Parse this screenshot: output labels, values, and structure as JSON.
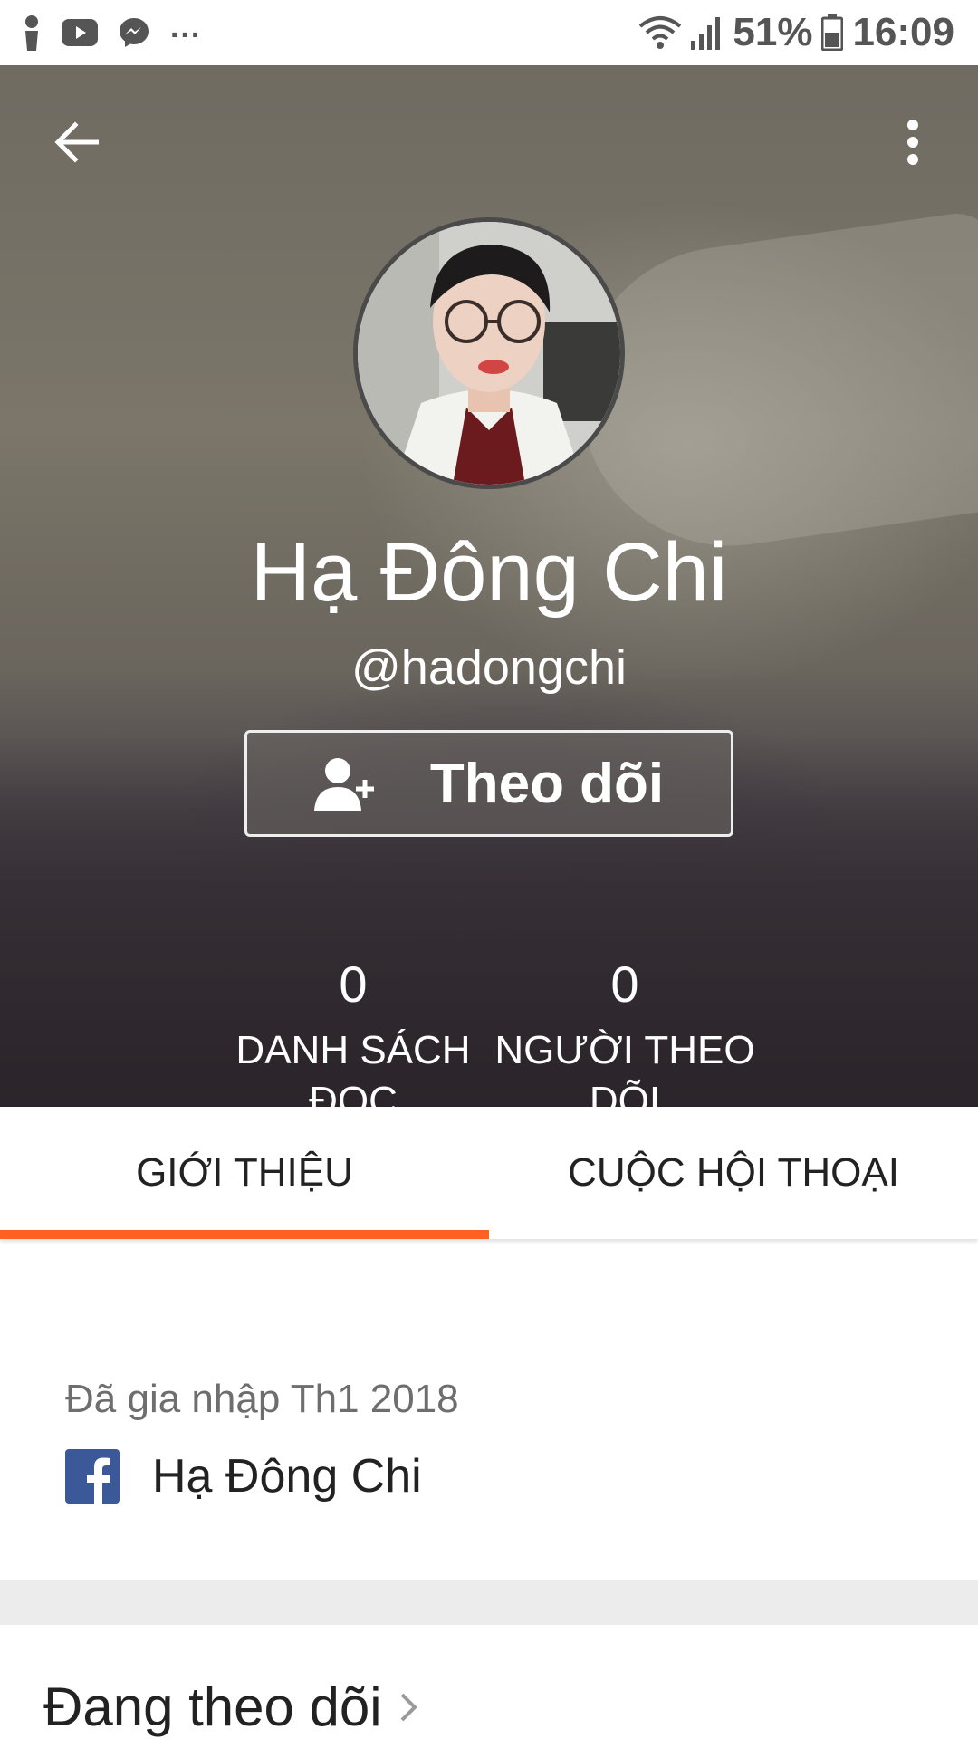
{
  "status_bar": {
    "overflow_indicator": "...",
    "battery": "51%",
    "time": "16:09",
    "left_icons": [
      "person-icon",
      "youtube-icon",
      "messenger-icon"
    ],
    "right_icons": [
      "wifi-icon",
      "signal-icon",
      "battery-icon"
    ]
  },
  "header": {
    "back_icon": "arrow-left-icon",
    "menu_icon": "more-vertical-icon"
  },
  "profile": {
    "name": "Hạ Đông Chi",
    "username": "@hadongchi",
    "follow_button": "Theo dõi",
    "follow_icon": "add-person-icon"
  },
  "stats": {
    "reading_lists": {
      "count": "0",
      "label_line1": "DANH SÁCH",
      "label_line2": "ĐỌC"
    },
    "followers": {
      "count": "0",
      "label_line1": "NGƯỜI THEO",
      "label_line2": "DÕI"
    }
  },
  "tabs": [
    {
      "label": "GIỚI THIỆU",
      "active": true
    },
    {
      "label": "CUỘC HỘI THOẠI",
      "active": false
    }
  ],
  "about": {
    "joined": "Đã gia nhập Th1 2018",
    "facebook_name": "Hạ Đông Chi",
    "facebook_icon": "facebook-icon"
  },
  "following_section": {
    "title": "Đang theo dõi"
  },
  "colors": {
    "accent": "#ff6122",
    "facebook": "#3b5998"
  }
}
